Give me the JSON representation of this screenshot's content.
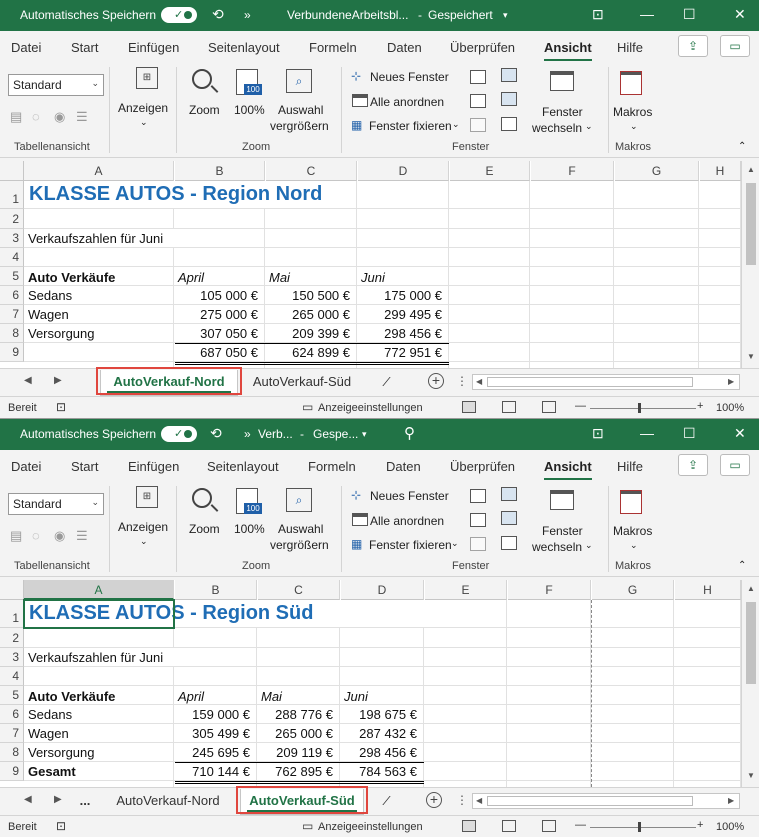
{
  "windows": [
    {
      "titlebar": {
        "autosave_label": "Automatisches Speichern",
        "file_name": "VerbundeneArbeitsbl...",
        "separator": "-",
        "save_state": "Gespeichert",
        "chevron": "»"
      },
      "menu": [
        "Datei",
        "Start",
        "Einfügen",
        "Seitenlayout",
        "Formeln",
        "Daten",
        "Überprüfen",
        "Ansicht",
        "Hilfe"
      ],
      "ribbon": {
        "view_select": "Standard",
        "group_tabellenansicht": "Tabellenansicht",
        "anzeigen": "Anzeigen",
        "zoom": "Zoom",
        "zoom100": "100%",
        "auswahl1": "Auswahl",
        "auswahl2": "vergrößern",
        "group_zoom": "Zoom",
        "neues_fenster": "Neues Fenster",
        "alle_anordnen": "Alle anordnen",
        "fenster_fixieren": "Fenster fixieren",
        "fenster_wechseln1": "Fenster",
        "fenster_wechseln2": "wechseln",
        "group_fenster": "Fenster",
        "makros": "Makros",
        "group_makros": "Makros"
      },
      "columns": [
        "A",
        "B",
        "C",
        "D",
        "E",
        "F",
        "G",
        "H"
      ],
      "rows": [
        "1",
        "2",
        "3",
        "4",
        "5",
        "6",
        "7",
        "8",
        "9"
      ],
      "cells": {
        "title": "KLASSE AUTOS - Region Nord",
        "subtitle": "Verkaufszahlen für Juni",
        "header": [
          "Auto Verkäufe",
          "April",
          "Mai",
          "Juni"
        ],
        "data": [
          [
            "Sedans",
            "105 000 €",
            "150 500 €",
            "175 000 €"
          ],
          [
            "Wagen",
            "275 000 €",
            "265 000 €",
            "299 495 €"
          ],
          [
            "Versorgung",
            "307 050 €",
            "209 399 €",
            "298 456 €"
          ],
          [
            "",
            "687 050 €",
            "624 899 €",
            "772 951 €"
          ]
        ]
      },
      "sheets": [
        "AutoVerkauf-Nord",
        "AutoVerkauf-Süd"
      ],
      "active_sheet": "AutoVerkauf-Nord",
      "status": {
        "ready": "Bereit",
        "display_settings": "Anzeigeeinstellungen",
        "zoom": "100%"
      }
    },
    {
      "titlebar": {
        "autosave_label": "Automatisches Speichern",
        "file_name": "Verb...",
        "separator": "-",
        "save_state": "Gespe...",
        "chevron": "»"
      },
      "menu": [
        "Datei",
        "Start",
        "Einfügen",
        "Seitenlayout",
        "Formeln",
        "Daten",
        "Überprüfen",
        "Ansicht",
        "Hilfe"
      ],
      "ribbon": {
        "view_select": "Standard",
        "group_tabellenansicht": "Tabellenansicht",
        "anzeigen": "Anzeigen",
        "zoom": "Zoom",
        "zoom100": "100%",
        "auswahl1": "Auswahl",
        "auswahl2": "vergrößern",
        "group_zoom": "Zoom",
        "neues_fenster": "Neues Fenster",
        "alle_anordnen": "Alle anordnen",
        "fenster_fixieren": "Fenster fixieren",
        "fenster_wechseln1": "Fenster",
        "fenster_wechseln2": "wechseln",
        "group_fenster": "Fenster",
        "makros": "Makros",
        "group_makros": "Makros"
      },
      "columns": [
        "A",
        "B",
        "C",
        "D",
        "E",
        "F",
        "G",
        "H"
      ],
      "rows": [
        "1",
        "2",
        "3",
        "4",
        "5",
        "6",
        "7",
        "8",
        "9"
      ],
      "cells": {
        "title": "KLASSE AUTOS - Region Süd",
        "subtitle": "Verkaufszahlen für Juni",
        "header": [
          "Auto Verkäufe",
          "April",
          "Mai",
          "Juni"
        ],
        "data": [
          [
            "Sedans",
            "159 000 €",
            "288 776 €",
            "198 675 €"
          ],
          [
            "Wagen",
            "305 499 €",
            "265 000 €",
            "287 432 €"
          ],
          [
            "Versorgung",
            "245 695 €",
            "209 119 €",
            "298 456 €"
          ],
          [
            "Gesamt",
            "710 144 €",
            "762 895 €",
            "784 563 €"
          ]
        ]
      },
      "sheets": [
        "AutoVerkauf-Nord",
        "AutoVerkauf-Süd"
      ],
      "active_sheet": "AutoVerkauf-Süd",
      "status": {
        "ready": "Bereit",
        "display_settings": "Anzeigeeinstellungen",
        "zoom": "100%"
      }
    }
  ],
  "colors": {
    "excel_green": "#217346",
    "title_blue": "#1f6db5",
    "highlight_red": "#e0463e"
  }
}
